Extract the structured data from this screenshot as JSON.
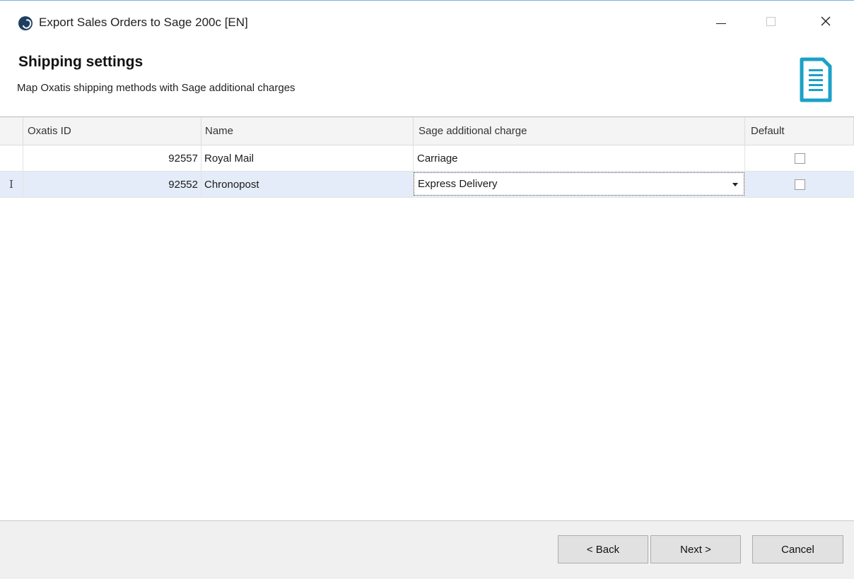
{
  "window": {
    "title": "Export Sales Orders to Sage 200c [EN]",
    "icons": {
      "app": "app-logo-icon",
      "minimize": "minimize-icon",
      "maximize": "maximize-icon",
      "close": "close-icon"
    }
  },
  "header": {
    "title": "Shipping settings",
    "subtitle": "Map Oxatis shipping methods with Sage additional charges",
    "icon": "document-list-icon",
    "accent_color": "#1ba1c7"
  },
  "grid": {
    "columns": {
      "id": "Oxatis ID",
      "name": "Name",
      "charge": "Sage additional charge",
      "default": "Default"
    },
    "rows": [
      {
        "id": "92557",
        "name": "Royal Mail",
        "charge": "Carriage",
        "default": false
      },
      {
        "id": "92552",
        "name": "Chronopost",
        "charge": "Express Delivery",
        "default": false,
        "editing": true,
        "indicator": "I"
      }
    ],
    "selected_row_color": "#e4ecf9"
  },
  "footer": {
    "back_label": "< Back",
    "next_label": "Next >",
    "cancel_label": "Cancel"
  }
}
